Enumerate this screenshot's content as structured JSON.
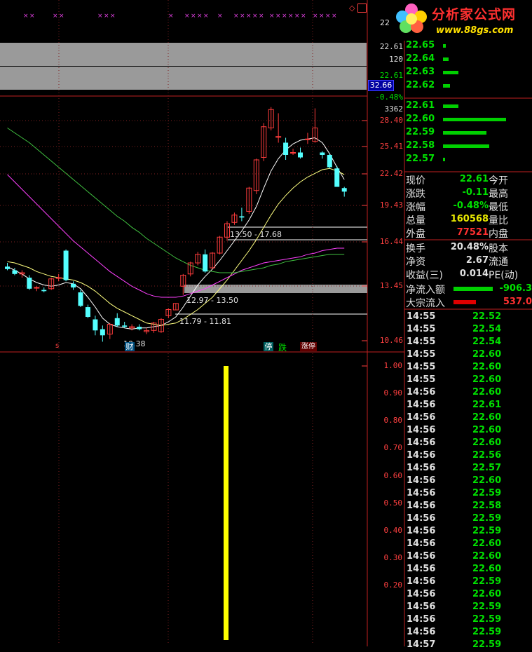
{
  "logo": {
    "title": "分析家公式网",
    "url": "www.88gs.com"
  },
  "main_axis": {
    "labels": [
      "28.40",
      "25.41",
      "22.42",
      "19.43",
      "16.44",
      "13.45",
      "10.46"
    ],
    "top_labels": [
      "22.61",
      "120",
      "22.61",
      "-0.48%",
      "3362"
    ],
    "highlight": "32.66",
    "cut_label": "22"
  },
  "sub_axis": {
    "labels": [
      "1.00",
      "0.90",
      "0.80",
      "0.70",
      "0.60",
      "0.50",
      "0.40",
      "0.30",
      "0.20"
    ]
  },
  "annotations": {
    "range1": "13.50 - 17.68",
    "range2": "12.97 - 13.50",
    "range3": "11.79 - 11.81",
    "low": "10.38",
    "tags": [
      "停",
      "跌",
      "涨停"
    ],
    "cai": "财",
    "s": "s"
  },
  "order_book": {
    "asks": [
      {
        "price": "22.65",
        "vol": 4
      },
      {
        "price": "22.64",
        "vol": 8
      },
      {
        "price": "22.63",
        "vol": 22
      },
      {
        "price": "22.62",
        "vol": 10
      }
    ],
    "bids": [
      {
        "price": "22.61",
        "vol": 22
      },
      {
        "price": "22.60",
        "vol": 90
      },
      {
        "price": "22.59",
        "vol": 62
      },
      {
        "price": "22.58",
        "vol": 66
      },
      {
        "price": "22.57",
        "vol": 3
      }
    ]
  },
  "quote": {
    "rows": [
      {
        "l1": "现价",
        "v": "22.61",
        "c": "#00e000",
        "l2": "今开"
      },
      {
        "l1": "涨跌",
        "v": "-0.11",
        "c": "#00e000",
        "l2": "最高"
      },
      {
        "l1": "涨幅",
        "v": "-0.48%",
        "c": "#00e000",
        "l2": "最低"
      },
      {
        "l1": "总量",
        "v": "160568",
        "c": "#e8e800",
        "l2": "量比"
      },
      {
        "l1": "外盘",
        "v": "77521",
        "c": "#ff3030",
        "l2": "内盘"
      },
      {
        "l1": "换手",
        "v": "20.48%",
        "c": "#e0e0e0",
        "l2": "股本"
      },
      {
        "l1": "净资",
        "v": "2.67",
        "c": "#e0e0e0",
        "l2": "流通"
      },
      {
        "l1": "收益(三)",
        "v": "0.014",
        "c": "#e0e0e0",
        "l2": "PE(动)"
      }
    ],
    "net_inflow_label": "净流入额",
    "net_inflow_value": "-906.3",
    "block_inflow_label": "大宗流入",
    "block_inflow_value": "537.0"
  },
  "ticks": [
    {
      "t": "14:55",
      "p": "22.52"
    },
    {
      "t": "14:55",
      "p": "22.54"
    },
    {
      "t": "14:55",
      "p": "22.54"
    },
    {
      "t": "14:55",
      "p": "22.60"
    },
    {
      "t": "14:55",
      "p": "22.60"
    },
    {
      "t": "14:55",
      "p": "22.60"
    },
    {
      "t": "14:56",
      "p": "22.60"
    },
    {
      "t": "14:56",
      "p": "22.61"
    },
    {
      "t": "14:56",
      "p": "22.60"
    },
    {
      "t": "14:56",
      "p": "22.60"
    },
    {
      "t": "14:56",
      "p": "22.60"
    },
    {
      "t": "14:56",
      "p": "22.56"
    },
    {
      "t": "14:56",
      "p": "22.57"
    },
    {
      "t": "14:56",
      "p": "22.60"
    },
    {
      "t": "14:56",
      "p": "22.59"
    },
    {
      "t": "14:56",
      "p": "22.58"
    },
    {
      "t": "14:56",
      "p": "22.59"
    },
    {
      "t": "14:56",
      "p": "22.59"
    },
    {
      "t": "14:56",
      "p": "22.60"
    },
    {
      "t": "14:56",
      "p": "22.60"
    },
    {
      "t": "14:56",
      "p": "22.60"
    },
    {
      "t": "14:56",
      "p": "22.59"
    },
    {
      "t": "14:56",
      "p": "22.60"
    },
    {
      "t": "14:56",
      "p": "22.59"
    },
    {
      "t": "14:56",
      "p": "22.59"
    },
    {
      "t": "14:56",
      "p": "22.59"
    },
    {
      "t": "14:57",
      "p": "22.59"
    }
  ],
  "chart_data": {
    "type": "candlestick",
    "y_axis_labels": [
      "28.40",
      "25.41",
      "22.42",
      "19.43",
      "16.44",
      "13.45",
      "10.46"
    ],
    "ylim": [
      10.46,
      28.4
    ],
    "candles": [
      {
        "o": 16.5,
        "h": 16.8,
        "l": 16.2,
        "c": 16.3
      },
      {
        "o": 16.2,
        "h": 16.4,
        "l": 15.8,
        "c": 15.9
      },
      {
        "o": 15.9,
        "h": 16.2,
        "l": 15.6,
        "c": 16.0
      },
      {
        "o": 15.6,
        "h": 15.8,
        "l": 14.6,
        "c": 14.7
      },
      {
        "o": 14.8,
        "h": 14.9,
        "l": 14.5,
        "c": 14.8
      },
      {
        "o": 14.6,
        "h": 14.8,
        "l": 14.4,
        "c": 14.5
      },
      {
        "o": 14.7,
        "h": 15.6,
        "l": 14.6,
        "c": 15.5
      },
      {
        "o": 15.6,
        "h": 15.9,
        "l": 15.3,
        "c": 15.6
      },
      {
        "o": 17.8,
        "h": 17.9,
        "l": 15.3,
        "c": 15.4
      },
      {
        "o": 15.1,
        "h": 15.3,
        "l": 14.6,
        "c": 14.8
      },
      {
        "o": 14.4,
        "h": 14.6,
        "l": 13.2,
        "c": 13.3
      },
      {
        "o": 13.2,
        "h": 13.4,
        "l": 12.3,
        "c": 12.4
      },
      {
        "o": 12.2,
        "h": 12.5,
        "l": 10.9,
        "c": 11.3
      },
      {
        "o": 11.4,
        "h": 11.7,
        "l": 10.38,
        "c": 10.9
      },
      {
        "o": 11.0,
        "h": 11.9,
        "l": 10.6,
        "c": 11.8
      },
      {
        "o": 12.3,
        "h": 12.7,
        "l": 11.6,
        "c": 11.7
      },
      {
        "o": 11.7,
        "h": 12.0,
        "l": 11.5,
        "c": 11.6
      },
      {
        "o": 11.5,
        "h": 11.8,
        "l": 11.3,
        "c": 11.6
      },
      {
        "o": 11.6,
        "h": 11.8,
        "l": 11.3,
        "c": 11.4
      },
      {
        "o": 11.2,
        "h": 11.5,
        "l": 11.0,
        "c": 11.3
      },
      {
        "o": 11.3,
        "h": 12.0,
        "l": 11.1,
        "c": 11.9
      },
      {
        "o": 11.2,
        "h": 12.3,
        "l": 11.1,
        "c": 12.2
      },
      {
        "o": 12.5,
        "h": 13.1,
        "l": 12.3,
        "c": 13.0
      },
      {
        "o": 12.97,
        "h": 13.5,
        "l": 12.97,
        "c": 13.5
      },
      {
        "o": 14.9,
        "h": 15.9,
        "l": 14.2,
        "c": 15.8
      },
      {
        "o": 15.9,
        "h": 16.9,
        "l": 15.7,
        "c": 16.8
      },
      {
        "o": 16.8,
        "h": 17.7,
        "l": 16.6,
        "c": 17.5
      },
      {
        "o": 17.5,
        "h": 17.9,
        "l": 16.0,
        "c": 16.1
      },
      {
        "o": 16.4,
        "h": 17.68,
        "l": 16.3,
        "c": 17.6
      },
      {
        "o": 17.6,
        "h": 19.0,
        "l": 17.5,
        "c": 18.9
      },
      {
        "o": 18.9,
        "h": 20.2,
        "l": 18.6,
        "c": 20.0
      },
      {
        "o": 20.1,
        "h": 20.9,
        "l": 19.9,
        "c": 20.7
      },
      {
        "o": 20.6,
        "h": 21.3,
        "l": 20.2,
        "c": 20.5
      },
      {
        "o": 21.0,
        "h": 23.0,
        "l": 20.8,
        "c": 22.9
      },
      {
        "o": 22.7,
        "h": 25.3,
        "l": 22.4,
        "c": 25.2
      },
      {
        "o": 25.4,
        "h": 28.2,
        "l": 25.1,
        "c": 27.9
      },
      {
        "o": 27.8,
        "h": 29.5,
        "l": 27.6,
        "c": 29.3
      },
      {
        "o": 27.1,
        "h": 29.0,
        "l": 26.6,
        "c": 27.1
      },
      {
        "o": 26.6,
        "h": 27.0,
        "l": 25.2,
        "c": 25.6
      },
      {
        "o": 25.8,
        "h": 26.1,
        "l": 25.6,
        "c": 25.8
      },
      {
        "o": 25.8,
        "h": 26.2,
        "l": 25.3,
        "c": 25.4
      },
      {
        "o": 26.9,
        "h": 27.4,
        "l": 26.5,
        "c": 26.9
      },
      {
        "o": 26.7,
        "h": 29.4,
        "l": 26.6,
        "c": 27.8
      },
      {
        "o": 25.8,
        "h": 25.9,
        "l": 25.3,
        "c": 25.6
      },
      {
        "o": 25.6,
        "h": 25.7,
        "l": 24.5,
        "c": 24.6
      },
      {
        "o": 24.5,
        "h": 24.7,
        "l": 23.0,
        "c": 23.0
      },
      {
        "o": 22.9,
        "h": 23.0,
        "l": 22.2,
        "c": 22.61
      }
    ],
    "ma_lines": [
      {
        "name": "MA5",
        "color": "#ffffff",
        "values": [
          16.5,
          16.2,
          15.9,
          15.5,
          15.2,
          15.0,
          14.9,
          15.0,
          15.2,
          15.1,
          14.7,
          14.0,
          13.2,
          12.3,
          11.8,
          11.6,
          11.5,
          11.4,
          11.5,
          11.5,
          11.6,
          11.7,
          12.0,
          12.4,
          13.2,
          14.1,
          15.0,
          15.7,
          16.3,
          17.0,
          17.8,
          18.6,
          19.4,
          20.3,
          21.4,
          22.9,
          24.3,
          25.3,
          26.0,
          26.5,
          26.8,
          26.9,
          27.0,
          26.6,
          25.7,
          24.6,
          23.6
        ]
      },
      {
        "name": "MA10",
        "color": "#ffff80",
        "values": [
          16.9,
          16.8,
          16.6,
          16.4,
          16.1,
          15.9,
          15.7,
          15.6,
          15.5,
          15.4,
          15.2,
          14.9,
          14.5,
          14.0,
          13.5,
          13.1,
          12.8,
          12.5,
          12.2,
          11.9,
          11.8,
          11.7,
          11.8,
          11.9,
          12.2,
          12.6,
          13.0,
          13.5,
          14.0,
          14.7,
          15.4,
          16.2,
          17.0,
          17.8,
          18.7,
          19.7,
          20.7,
          21.6,
          22.3,
          22.9,
          23.4,
          23.8,
          24.1,
          24.4,
          24.5,
          24.3,
          24.0
        ]
      },
      {
        "name": "MA20",
        "color": "#ff40ff",
        "values": [
          24.0,
          23.4,
          22.8,
          22.2,
          21.6,
          21.0,
          20.4,
          19.8,
          19.2,
          18.6,
          18.1,
          17.6,
          17.1,
          16.6,
          16.1,
          15.7,
          15.3,
          14.9,
          14.6,
          14.3,
          14.1,
          14.0,
          14.0,
          14.0,
          14.1,
          14.3,
          14.5,
          14.7,
          15.0,
          15.3,
          15.6,
          15.9,
          16.2,
          16.4,
          16.6,
          16.8,
          16.9,
          17.0,
          17.1,
          17.2,
          17.3,
          17.5,
          17.6,
          17.8,
          17.9,
          18.0,
          18.0
        ]
      },
      {
        "name": "MA60",
        "color": "#40c040",
        "values": [
          27.8,
          27.4,
          27.0,
          26.6,
          26.1,
          25.6,
          25.1,
          24.6,
          24.1,
          23.6,
          23.1,
          22.6,
          22.1,
          21.6,
          21.1,
          20.6,
          20.2,
          19.7,
          19.3,
          18.8,
          18.4,
          18.0,
          17.6,
          17.2,
          16.9,
          16.6,
          16.4,
          16.2,
          16.1,
          16.0,
          16.0,
          16.0,
          16.1,
          16.2,
          16.3,
          16.4,
          16.6,
          16.7,
          16.9,
          17.0,
          17.1,
          17.2,
          17.3,
          17.4,
          17.5,
          17.5,
          17.5
        ]
      }
    ],
    "sub_chart": {
      "type": "bar",
      "ylim": [
        0.1,
        1.0
      ],
      "value": 1.0
    }
  }
}
